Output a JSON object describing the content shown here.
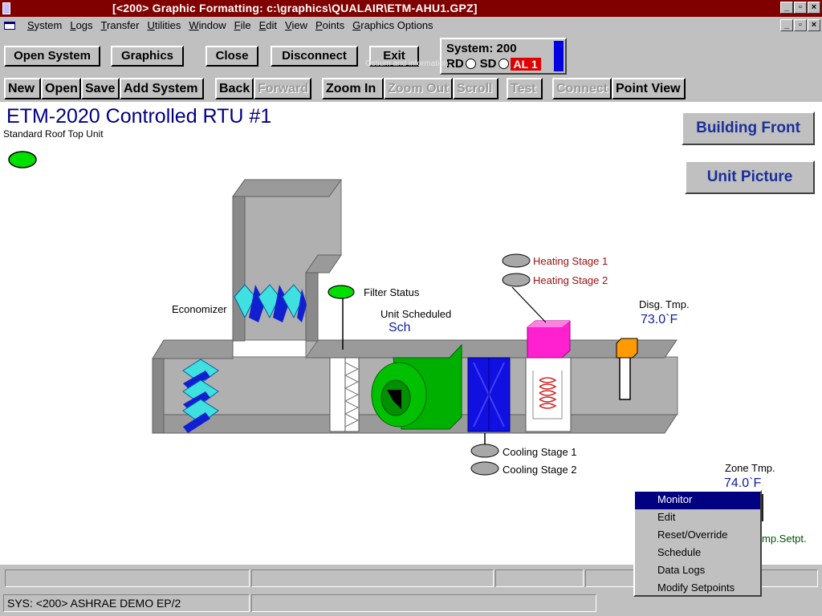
{
  "titlebar": {
    "title": "[<200> Graphic Formatting: c:\\graphics\\QUALAIR\\ETM-AHU1.GPZ]"
  },
  "menu": [
    "System",
    "Logs",
    "Transfer",
    "Utilities",
    "Window",
    "File",
    "Edit",
    "View",
    "Points",
    "Graphics Options"
  ],
  "toolbar1": {
    "open_system": "Open System",
    "graphics": "Graphics",
    "close": "Close",
    "disconnect": "Disconnect",
    "exit": "Exit",
    "faint_text": "Ostium and information"
  },
  "system_box": {
    "label": "System: 200",
    "rd": "RD",
    "sd": "SD",
    "alarm": "AL 1"
  },
  "toolbar2": [
    {
      "label": "New",
      "enabled": true
    },
    {
      "label": "Open",
      "enabled": true
    },
    {
      "label": "Save",
      "enabled": true
    },
    {
      "label": "Add System",
      "enabled": true
    },
    {
      "label": "Back",
      "enabled": true
    },
    {
      "label": "Forward",
      "enabled": false
    },
    {
      "label": "Zoom In",
      "enabled": true
    },
    {
      "label": "Zoom Out",
      "enabled": false
    },
    {
      "label": "Scroll",
      "enabled": false
    },
    {
      "label": "Test",
      "enabled": false
    },
    {
      "label": "Connect",
      "enabled": false
    },
    {
      "label": "Point View",
      "enabled": true
    }
  ],
  "page": {
    "title": "ETM-2020 Controlled RTU #1",
    "subtitle": "Standard Roof Top Unit",
    "building_front": "Building Front",
    "unit_picture": "Unit Picture"
  },
  "diagram": {
    "economizer": "Economizer",
    "filter_status": "Filter Status",
    "unit_scheduled": "Unit Scheduled",
    "unit_scheduled_value": "Sch",
    "heating_stage_1": "Heating Stage 1",
    "heating_stage_2": "Heating Stage 2",
    "disch_tmp": "Disg. Tmp.",
    "disch_tmp_value": "73.0`F",
    "cooling_stage_1": "Cooling Stage 1",
    "cooling_stage_2": "Cooling Stage 2",
    "zone_tmp": "Zone Tmp.",
    "zone_tmp_value": "74.0`F",
    "zone_setpt_partial": "mp.Setpt."
  },
  "context_menu": [
    "Monitor",
    "Edit",
    "Reset/Override",
    "Schedule",
    "Data Logs",
    "Modify Setpoints"
  ],
  "status": {
    "sys": "SYS: <200> ASHRAE DEMO EP/2"
  },
  "colors": {
    "title": "#800000",
    "heading": "#000080",
    "link_button_text": "#1a2f9a",
    "alarm": "#e00000",
    "status_on": "#00e000",
    "duct": "#b0b0b0"
  }
}
